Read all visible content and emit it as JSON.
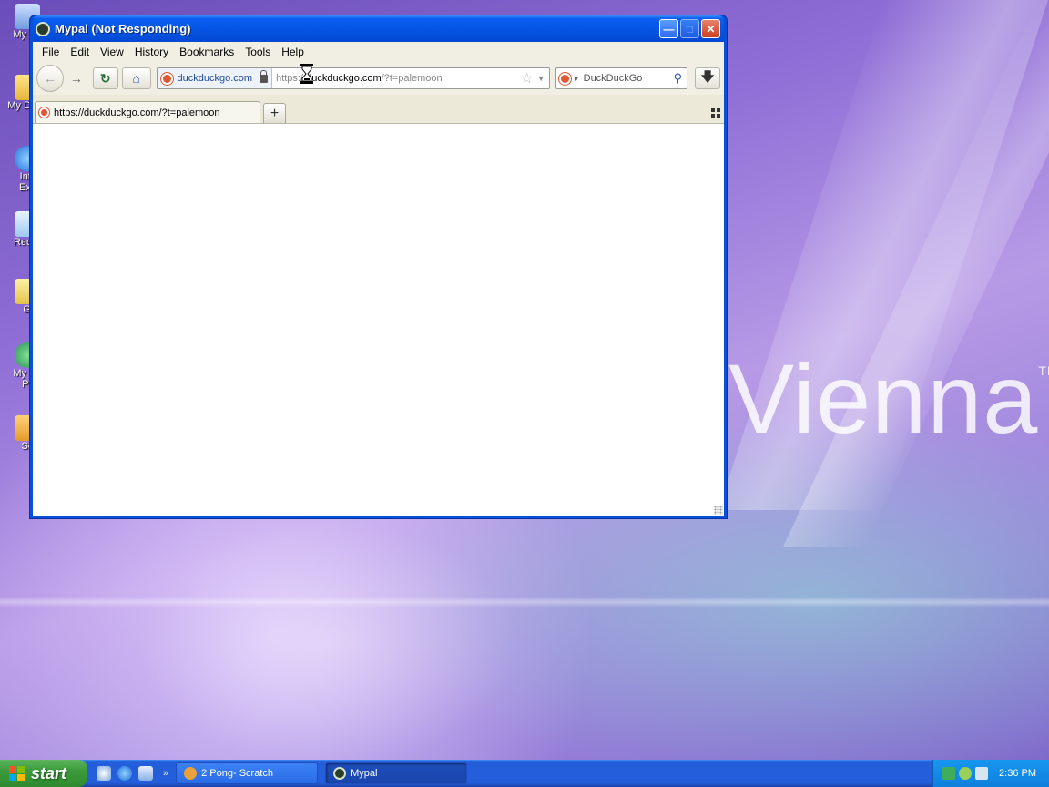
{
  "desktop": {
    "brand_text": "Vienna",
    "brand_mark": "TM",
    "icons": [
      {
        "label": "My C",
        "icon": "my-computer-icon"
      },
      {
        "label": "My Do",
        "icon": "my-documents-icon"
      },
      {
        "label": "Inte Exp",
        "icon": "internet-explorer-icon"
      },
      {
        "label": "Recy",
        "icon": "recycle-bin-icon"
      },
      {
        "label": "Ga",
        "icon": "games-shortcut-icon"
      },
      {
        "label": "My N Pla",
        "icon": "my-network-places-icon"
      },
      {
        "label": "Scr",
        "icon": "scratch-shortcut-icon"
      }
    ]
  },
  "window": {
    "title": "Mypal (Not Responding)",
    "menu": [
      "File",
      "Edit",
      "View",
      "History",
      "Bookmarks",
      "Tools",
      "Help"
    ],
    "identity": "duckduckgo.com",
    "url": {
      "prefix": "https://",
      "host": "duckduckgo.com",
      "path": "/?t=palemoon"
    },
    "search_engine": "DuckDuckGo",
    "tab": {
      "title": "https://duckduckgo.com/?t=palemoon"
    },
    "newtab_label": "+"
  },
  "taskbar": {
    "start_label": "start",
    "tasks": [
      {
        "label": "2 Pong- Scratch",
        "active": false
      },
      {
        "label": "Mypal",
        "active": true
      }
    ],
    "clock": "2:36 PM"
  },
  "colors": {
    "titlebar": "#0656e6",
    "taskbar": "#245edb",
    "start_button": "#3c9b3c",
    "ddg_orange": "#de5833"
  }
}
